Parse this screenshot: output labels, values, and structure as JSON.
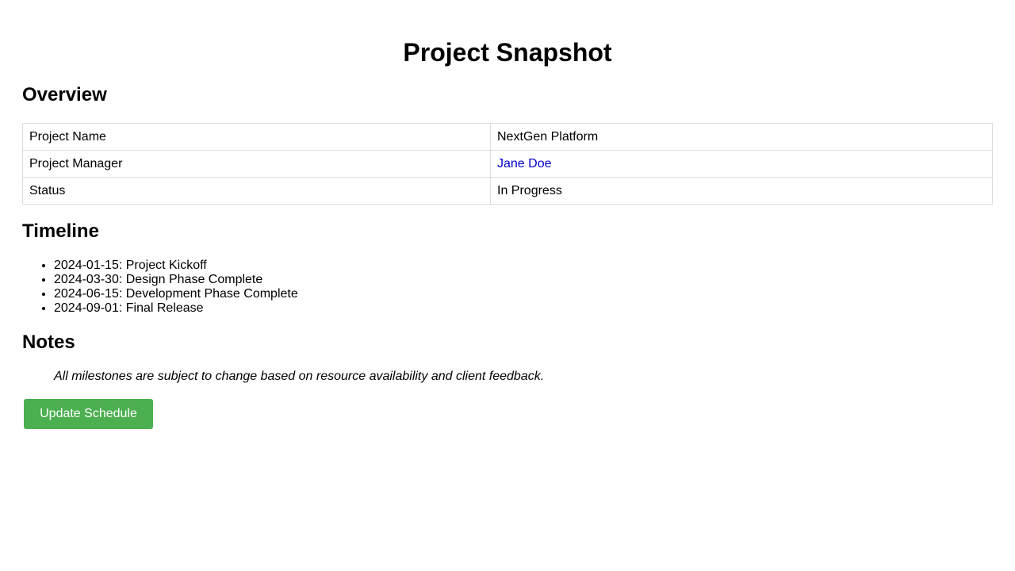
{
  "page": {
    "title": "Project Snapshot"
  },
  "overview": {
    "heading": "Overview",
    "rows": [
      {
        "label": "Project Name",
        "value": "NextGen Platform"
      },
      {
        "label": "Project Manager",
        "value": "Jane Doe"
      },
      {
        "label": "Status",
        "value": "In Progress"
      }
    ],
    "link_color": "#0000cc"
  },
  "timeline": {
    "heading": "Timeline",
    "items": [
      "2024-01-15: Project Kickoff",
      "2024-03-30: Design Phase Complete",
      "2024-06-15: Development Phase Complete",
      "2024-09-01: Final Release"
    ]
  },
  "notes": {
    "heading": "Notes",
    "text": "All milestones are subject to change based on resource availability and client feedback."
  },
  "actions": {
    "update_label": "Update Schedule",
    "button_color": "#4caf50"
  }
}
